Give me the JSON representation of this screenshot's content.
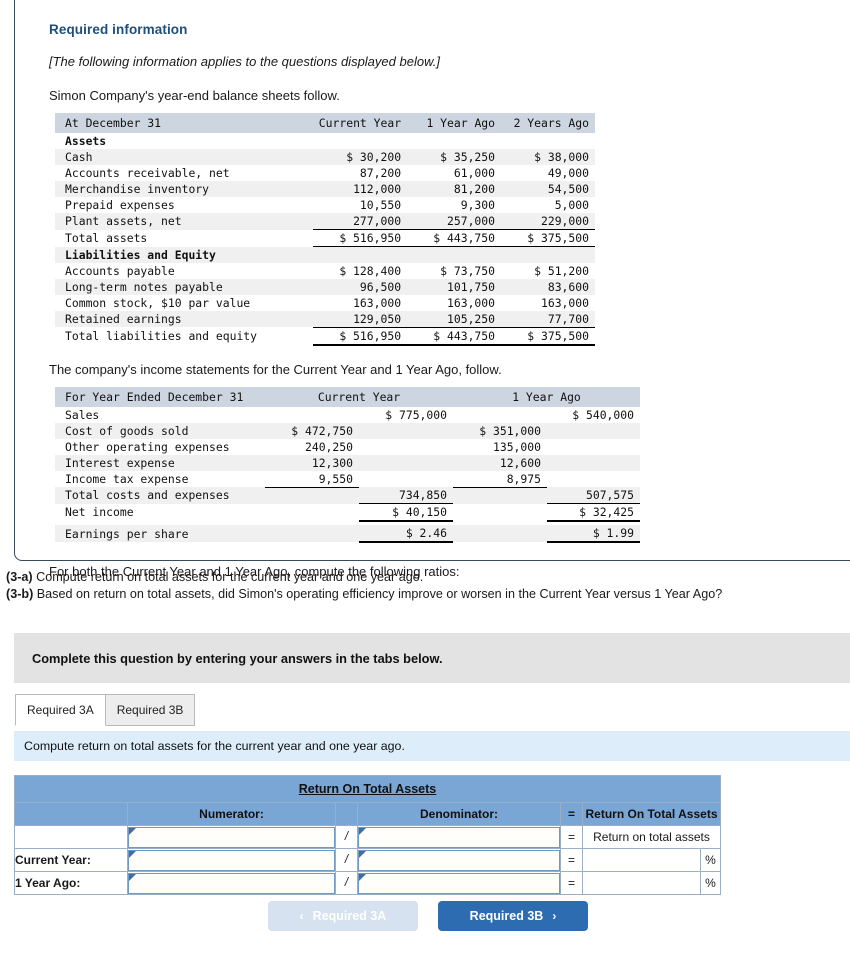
{
  "info": {
    "required_title": "Required information",
    "applies_note": "[The following information applies to the questions displayed below.]",
    "balance_intro": "Simon Company's year-end balance sheets follow.",
    "income_intro": "The company's income statements for the Current Year and 1 Year Ago, follow.",
    "ratios_line": "For both the Current Year and 1 Year Ago, compute the following ratios:"
  },
  "balance_sheet": {
    "header": [
      "At December 31",
      "Current Year",
      "1 Year Ago",
      "2 Years Ago"
    ],
    "section_assets": "Assets",
    "section_liab": "Liabilities and Equity",
    "asset_rows": [
      {
        "label": "Cash",
        "c1": "$ 30,200",
        "c2": "$ 35,250",
        "c3": "$ 38,000"
      },
      {
        "label": "Accounts receivable, net",
        "c1": "87,200",
        "c2": "61,000",
        "c3": "49,000"
      },
      {
        "label": "Merchandise inventory",
        "c1": "112,000",
        "c2": "81,200",
        "c3": "54,500"
      },
      {
        "label": "Prepaid expenses",
        "c1": "10,550",
        "c2": "9,300",
        "c3": "5,000"
      },
      {
        "label": "Plant assets, net",
        "c1": "277,000",
        "c2": "257,000",
        "c3": "229,000"
      }
    ],
    "total_assets": {
      "label": "Total assets",
      "c1": "$ 516,950",
      "c2": "$ 443,750",
      "c3": "$ 375,500"
    },
    "liab_rows": [
      {
        "label": "Accounts payable",
        "c1": "$ 128,400",
        "c2": "$ 73,750",
        "c3": "$ 51,200"
      },
      {
        "label": "Long-term notes payable",
        "c1": "96,500",
        "c2": "101,750",
        "c3": "83,600"
      },
      {
        "label": "Common stock, $10 par value",
        "c1": "163,000",
        "c2": "163,000",
        "c3": "163,000"
      },
      {
        "label": "Retained earnings",
        "c1": "129,050",
        "c2": "105,250",
        "c3": "77,700"
      }
    ],
    "total_liab_equity": {
      "label": "Total liabilities and equity",
      "c1": "$ 516,950",
      "c2": "$ 443,750",
      "c3": "$ 375,500"
    }
  },
  "income_statement": {
    "header": [
      "For Year Ended December 31",
      "Current Year",
      "1 Year Ago"
    ],
    "rows": [
      {
        "label": "Sales",
        "cy_sub": "",
        "cy_tot": "$ 775,000",
        "py_sub": "",
        "py_tot": "$ 540,000"
      },
      {
        "label": "Cost of goods sold",
        "cy_sub": "$ 472,750",
        "cy_tot": "",
        "py_sub": "$ 351,000",
        "py_tot": ""
      },
      {
        "label": "Other operating expenses",
        "cy_sub": "240,250",
        "cy_tot": "",
        "py_sub": "135,000",
        "py_tot": ""
      },
      {
        "label": "Interest expense",
        "cy_sub": "12,300",
        "cy_tot": "",
        "py_sub": "12,600",
        "py_tot": ""
      },
      {
        "label": "Income tax expense",
        "cy_sub": "9,550",
        "cy_tot": "",
        "py_sub": "8,975",
        "py_tot": ""
      }
    ],
    "total_costs": {
      "label": "Total costs and expenses",
      "cy_tot": "734,850",
      "py_tot": "507,575"
    },
    "net_income": {
      "label": "Net income",
      "cy_tot": "$ 40,150",
      "py_tot": "$ 32,425"
    },
    "eps": {
      "label": "Earnings per share",
      "cy_tot": "$ 2.46",
      "py_tot": "$ 1.99"
    }
  },
  "questions": {
    "a_tag": "(3-a)",
    "a_text": " Compute return on total assets for the current year and one year ago.",
    "b_tag": "(3-b)",
    "b_text": " Based on return on total assets, did Simon's operating efficiency improve or worsen in the Current Year versus 1 Year Ago?"
  },
  "instruction_bar": "Complete this question by entering your answers in the tabs below.",
  "tabs": [
    {
      "label": "Required 3A",
      "active": true
    },
    {
      "label": "Required 3B",
      "active": false
    }
  ],
  "tab_prompt": "Compute return on total assets for the current year and one year ago.",
  "answer_table": {
    "title": "Return On Total Assets",
    "columns": {
      "numerator": "Numerator:",
      "slash": "/",
      "denominator": "Denominator:",
      "equals": "=",
      "result": "Return On Total Assets"
    },
    "rows": [
      {
        "label": "",
        "numerator": "",
        "denominator": "",
        "result": "Return on total assets",
        "pct": ""
      },
      {
        "label": "Current Year:",
        "numerator": "",
        "denominator": "",
        "result": "",
        "pct": "%"
      },
      {
        "label": "1 Year Ago:",
        "numerator": "",
        "denominator": "",
        "result": "",
        "pct": "%"
      }
    ]
  },
  "footer": {
    "prev_label": "Required 3A",
    "prev_icon": "chevron-left-icon",
    "next_label": "Required 3B",
    "next_icon": "chevron-right-icon"
  },
  "colors": {
    "accent_blue": "#2d6cb0",
    "table_header_blue": "#7aa6d6",
    "info_title_blue": "#1f4e79",
    "strip_blue": "#ddedf9",
    "grey_bar": "#e3e3e3"
  }
}
